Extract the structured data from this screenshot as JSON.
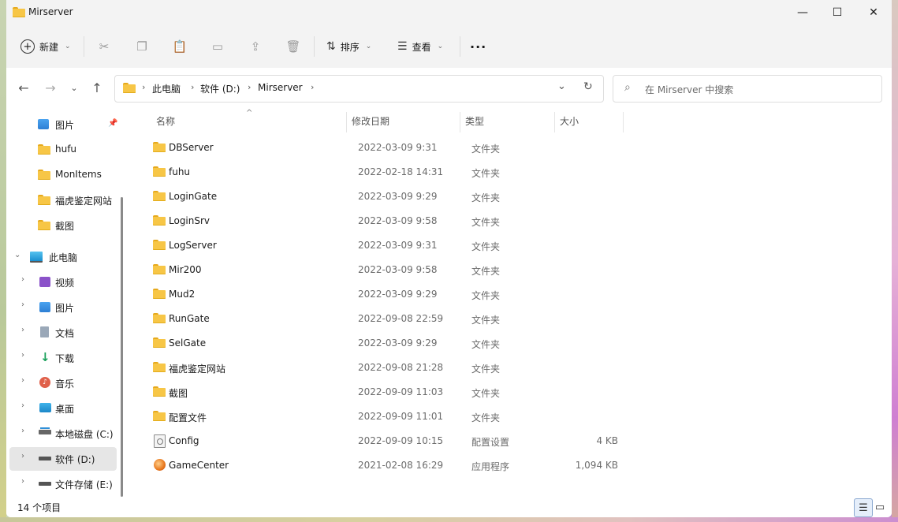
{
  "window": {
    "title": "Mirserver",
    "minimize_glyph": "—",
    "maximize_glyph": "☐",
    "close_glyph": "✕"
  },
  "commandbar": {
    "new_label": "新建",
    "sort_label": "排序",
    "view_label": "查看",
    "more_glyph": "···",
    "icons": [
      "cut-icon",
      "copy-icon",
      "paste-icon",
      "rename-icon",
      "share-icon",
      "delete-icon"
    ]
  },
  "navigation": {
    "back": "←",
    "forward": "→",
    "recent": "⌄",
    "up": "↑",
    "refresh": "↻",
    "dropdown": "⌄"
  },
  "address": {
    "segments": [
      "此电脑",
      "软件 (D:)",
      "Mirserver"
    ]
  },
  "search": {
    "placeholder": "在 Mirserver 中搜索"
  },
  "sidebar": {
    "quick": [
      {
        "label": "图片",
        "icon": "pictures-icon",
        "pinned": true
      },
      {
        "label": "hufu",
        "icon": "folder-icon"
      },
      {
        "label": "MonItems",
        "icon": "folder-icon"
      },
      {
        "label": "福虎鉴定网站",
        "icon": "folder-icon"
      },
      {
        "label": "截图",
        "icon": "folder-icon"
      }
    ],
    "this_pc": {
      "label": "此电脑",
      "icon": "computer-icon"
    },
    "pc_items": [
      {
        "label": "视频",
        "icon": "videos-icon"
      },
      {
        "label": "图片",
        "icon": "pictures-icon"
      },
      {
        "label": "文档",
        "icon": "documents-icon"
      },
      {
        "label": "下载",
        "icon": "downloads-icon"
      },
      {
        "label": "音乐",
        "icon": "music-icon"
      },
      {
        "label": "桌面",
        "icon": "desktop-icon"
      },
      {
        "label": "本地磁盘 (C:)",
        "icon": "drive-c-icon"
      },
      {
        "label": "软件 (D:)",
        "icon": "drive-icon",
        "selected": true
      },
      {
        "label": "文件存储 (E:)",
        "icon": "drive-icon"
      }
    ]
  },
  "columns": {
    "name": "名称",
    "date": "修改日期",
    "type": "类型",
    "size": "大小",
    "sort_glyph": "^"
  },
  "files": [
    {
      "name": "DBServer",
      "date": "2022-03-09 9:31",
      "type": "文件夹",
      "size": "",
      "icon": "folder-icon"
    },
    {
      "name": "fuhu",
      "date": "2022-02-18 14:31",
      "type": "文件夹",
      "size": "",
      "icon": "folder-icon"
    },
    {
      "name": "LoginGate",
      "date": "2022-03-09 9:29",
      "type": "文件夹",
      "size": "",
      "icon": "folder-icon"
    },
    {
      "name": "LoginSrv",
      "date": "2022-03-09 9:58",
      "type": "文件夹",
      "size": "",
      "icon": "folder-icon"
    },
    {
      "name": "LogServer",
      "date": "2022-03-09 9:31",
      "type": "文件夹",
      "size": "",
      "icon": "folder-icon"
    },
    {
      "name": "Mir200",
      "date": "2022-03-09 9:58",
      "type": "文件夹",
      "size": "",
      "icon": "folder-icon"
    },
    {
      "name": "Mud2",
      "date": "2022-03-09 9:29",
      "type": "文件夹",
      "size": "",
      "icon": "folder-icon"
    },
    {
      "name": "RunGate",
      "date": "2022-09-08 22:59",
      "type": "文件夹",
      "size": "",
      "icon": "folder-icon"
    },
    {
      "name": "SelGate",
      "date": "2022-03-09 9:29",
      "type": "文件夹",
      "size": "",
      "icon": "folder-icon"
    },
    {
      "name": "福虎鉴定网站",
      "date": "2022-09-08 21:28",
      "type": "文件夹",
      "size": "",
      "icon": "folder-icon"
    },
    {
      "name": "截图",
      "date": "2022-09-09 11:03",
      "type": "文件夹",
      "size": "",
      "icon": "folder-icon"
    },
    {
      "name": "配置文件",
      "date": "2022-09-09 11:01",
      "type": "文件夹",
      "size": "",
      "icon": "folder-icon"
    },
    {
      "name": "Config",
      "date": "2022-09-09 10:15",
      "type": "配置设置",
      "size": "4 KB",
      "icon": "config-file-icon"
    },
    {
      "name": "GameCenter",
      "date": "2021-02-08 16:29",
      "type": "应用程序",
      "size": "1,094 KB",
      "icon": "app-icon"
    }
  ],
  "status": {
    "item_count": "14 个项目"
  }
}
